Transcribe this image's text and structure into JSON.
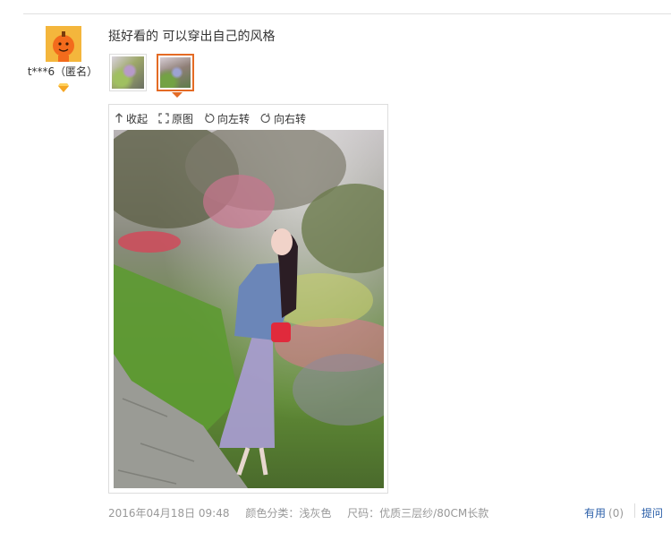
{
  "reviewer": {
    "name": "t***6（匿名）",
    "avatar_icon": "orange-mascot-avatar",
    "level_icon": "diamond-icon",
    "level_color": "#f5a623"
  },
  "review": {
    "text": "挺好看的 可以穿出自己的风格",
    "thumbnails": [
      "photo-thumbnail-1",
      "photo-thumbnail-2"
    ],
    "selected_thumbnail": 1
  },
  "viewer": {
    "toolbar": {
      "collapse": "收起",
      "original": "原图",
      "rotate_left": "向左转",
      "rotate_right": "向右转"
    },
    "photo_subject": "review-photo"
  },
  "meta": {
    "date": "2016年04月18日 09:48",
    "color": "颜色分类：浅灰色",
    "size": "尺码：优质三层纱/80CM长款"
  },
  "actions": {
    "useful_label": "有用",
    "useful_count": "(0)",
    "ask_label": "提问"
  },
  "colors": {
    "accent": "#e46b25",
    "link": "#2b5fa9",
    "muted": "#999999"
  }
}
